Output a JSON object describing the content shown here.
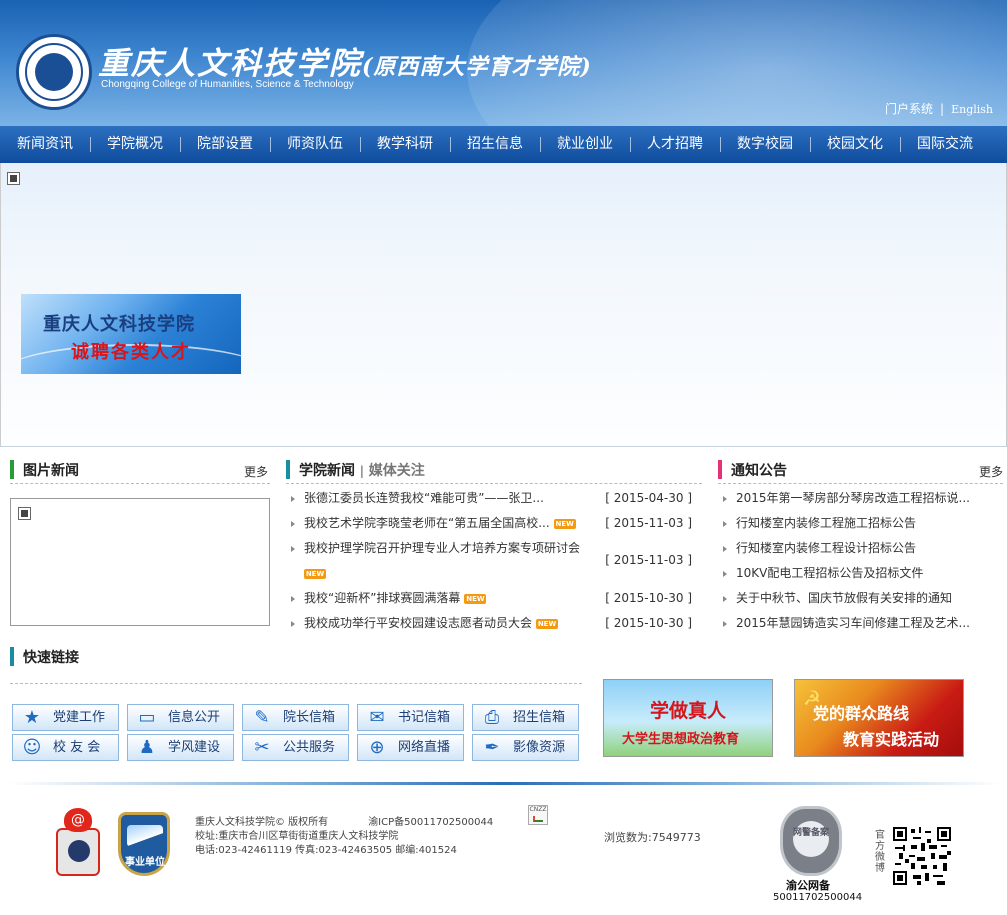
{
  "header": {
    "school_cn": "重庆人文科技学院",
    "school_cn_sub": "(原西南大学育才学院)",
    "school_en": "Chongqing College of Humanities, Science & Technology",
    "portal_link": "门户系统",
    "separator": "|",
    "english_link": "English"
  },
  "nav": {
    "items": [
      "新闻资讯",
      "学院概况",
      "院部设置",
      "师资队伍",
      "教学科研",
      "招生信息",
      "就业创业",
      "人才招聘",
      "数字校园",
      "校园文化",
      "国际交流"
    ]
  },
  "banner": {
    "recruit_line1": "重庆人文科技学院",
    "recruit_line2": "诚聘各类人才"
  },
  "pic_news": {
    "title": "图片新闻",
    "more": "更多"
  },
  "college_news": {
    "title": "学院新闻",
    "divider": "|",
    "title_alt": "媒体关注",
    "items": [
      {
        "text": "张德江委员长连赞我校“难能可贵”——张卫...",
        "date": "[ 2015-04-30 ]",
        "new": ""
      },
      {
        "text": "我校艺术学院李晓莹老师在“第五届全国高校...",
        "date": "[ 2015-11-03 ]",
        "new": "NEW"
      },
      {
        "text": "我校护理学院召开护理专业人才培养方案专项研讨会",
        "date": "[ 2015-11-03 ]",
        "new": "NEW"
      },
      {
        "text": "我校“迎新杯”排球赛圆满落幕",
        "date": "[ 2015-10-30 ]",
        "new": "NEW"
      },
      {
        "text": "我校成功举行平安校园建设志愿者动员大会",
        "date": "[ 2015-10-30 ]",
        "new": "NEW"
      }
    ]
  },
  "notices": {
    "title": "通知公告",
    "more": "更多",
    "items": [
      "2015年第一琴房部分琴房改造工程招标说...",
      "行知楼室内装修工程施工招标公告",
      "行知楼室内装修工程设计招标公告",
      "10KV配电工程招标公告及招标文件",
      "关于中秋节、国庆节放假有关安排的通知",
      "2015年慧园铸造实习车间修建工程及艺术..."
    ]
  },
  "quick_links": {
    "title": "快速链接",
    "buttons": [
      {
        "label": "党建工作",
        "icon": "star-icon",
        "glyph": "★"
      },
      {
        "label": "信息公开",
        "icon": "chat-icon",
        "glyph": "▭"
      },
      {
        "label": "院长信箱",
        "icon": "edit-icon",
        "glyph": "✎"
      },
      {
        "label": "书记信箱",
        "icon": "mail-icon",
        "glyph": "✉"
      },
      {
        "label": "招生信箱",
        "icon": "printer-icon",
        "glyph": "⎙"
      },
      {
        "label": "校 友 会",
        "icon": "people-icon",
        "glyph": "☺"
      },
      {
        "label": "学风建设",
        "icon": "person-icon",
        "glyph": "♟"
      },
      {
        "label": "公共服务",
        "icon": "tools-icon",
        "glyph": "✂"
      },
      {
        "label": "网络直播",
        "icon": "globe-icon",
        "glyph": "⊕"
      },
      {
        "label": "影像资源",
        "icon": "feather-icon",
        "glyph": "✒"
      }
    ]
  },
  "promos": {
    "promo1_line1": "学做真人",
    "promo1_line2": "大学生思想政治教育",
    "promo2_line1": "党的群众路线",
    "promo2_line2": "教育实践活动"
  },
  "footer": {
    "copyright": "重庆人文科技学院© 版权所有",
    "icp": "渝ICP备50011702500044",
    "address": "校址:重庆市合川区草街街道重庆人文科技学院",
    "contact": "电话:023-42461119 传真:023-42463505 邮编:401524",
    "cnzz": "CNZZ",
    "visits": "浏览数为:7549773",
    "gongan_seal": "网警备案",
    "gongan_title": "渝公网备",
    "gongan_no": "50011702500044",
    "weibo": "官方微博",
    "unit_badge": "事业单位"
  },
  "colors": {
    "nav_bg": "#0f4c9e",
    "pic_news_bar": "#2a9b3a",
    "college_news_bar": "#1b8da0",
    "notice_bar": "#e5317a",
    "quick_bar": "#1b8da0"
  }
}
